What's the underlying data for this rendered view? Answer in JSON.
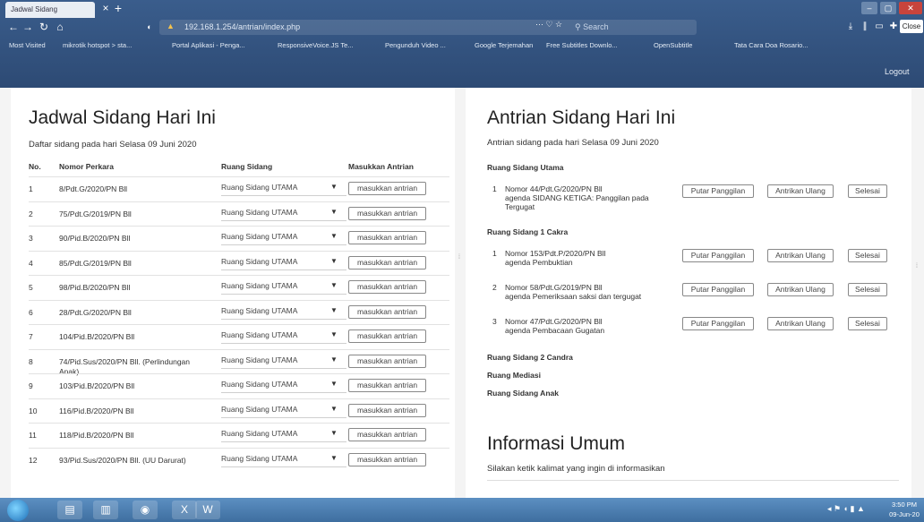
{
  "browser": {
    "tab_title": "Jadwal Sidang",
    "tab_close": "×",
    "tab_new": "+",
    "win_min": "–",
    "win_max": "▢",
    "win_close": "✕",
    "url": "192.168.1.254/antrian/index.php",
    "url_actions": "··· ♡ ☆",
    "search_placeholder": "Search",
    "close_label": "Close",
    "bookmarks": [
      "Most Visited",
      "mikrotik hotspot > sta...",
      "Portal Aplikasi - Penga...",
      "ResponsiveVoice.JS Te...",
      "Pengunduh Video ...",
      "Google Terjemahan",
      "Free Subtitles Downlo...",
      "OpenSubtitle",
      "Tata Cara Doa Rosario..."
    ],
    "logout": "Logout"
  },
  "left": {
    "title": "Jadwal Sidang Hari Ini",
    "subtitle": "Daftar sidang pada hari Selasa 09 Juni 2020",
    "headers": {
      "no": "No.",
      "perkara": "Nomor Perkara",
      "ruang": "Ruang Sidang",
      "antrian": "Masukkan Antrian"
    },
    "button_label": "masukkan antrian",
    "rows": [
      {
        "no": "1",
        "perkara": "8/Pdt.G/2020/PN Bll",
        "ruang": "Ruang Sidang UTAMA"
      },
      {
        "no": "2",
        "perkara": "75/Pdt.G/2019/PN Bll",
        "ruang": "Ruang Sidang UTAMA"
      },
      {
        "no": "3",
        "perkara": "90/Pid.B/2020/PN Bll",
        "ruang": "Ruang Sidang UTAMA"
      },
      {
        "no": "4",
        "perkara": "85/Pdt.G/2019/PN Bll",
        "ruang": "Ruang Sidang UTAMA"
      },
      {
        "no": "5",
        "perkara": "98/Pid.B/2020/PN Bll",
        "ruang": "Ruang Sidang UTAMA"
      },
      {
        "no": "6",
        "perkara": "28/Pdt.G/2020/PN Bll",
        "ruang": "Ruang Sidang UTAMA"
      },
      {
        "no": "7",
        "perkara": "104/Pid.B/2020/PN Bll",
        "ruang": "Ruang Sidang UTAMA"
      },
      {
        "no": "8",
        "perkara": "74/Pid.Sus/2020/PN Bll. (Perlindungan Anak)",
        "ruang": "Ruang Sidang UTAMA"
      },
      {
        "no": "9",
        "perkara": "103/Pid.B/2020/PN Bll",
        "ruang": "Ruang Sidang UTAMA"
      },
      {
        "no": "10",
        "perkara": "116/Pid.B/2020/PN Bll",
        "ruang": "Ruang Sidang UTAMA"
      },
      {
        "no": "11",
        "perkara": "118/Pid.B/2020/PN Bll",
        "ruang": "Ruang Sidang UTAMA"
      },
      {
        "no": "12",
        "perkara": "93/Pid.Sus/2020/PN Bll. (UU Darurat)",
        "ruang": "Ruang Sidang UTAMA"
      }
    ]
  },
  "right": {
    "title": "Antrian Sidang Hari Ini",
    "subtitle": "Antrian sidang pada hari Selasa 09 Juni 2020",
    "btn_putar": "Putar Panggilan",
    "btn_ulang": "Antrikan Ulang",
    "btn_selesai": "Selesai",
    "rooms": [
      {
        "name": "Ruang Sidang Utama",
        "items": [
          {
            "no": "1",
            "nomor": "Nomor 44/Pdt.G/2020/PN Bll",
            "agenda": "agenda SIDANG KETIGA: Panggilan pada Tergugat"
          }
        ]
      },
      {
        "name": "Ruang Sidang 1 Cakra",
        "items": [
          {
            "no": "1",
            "nomor": "Nomor 153/Pdt.P/2020/PN Bll",
            "agenda": "agenda Pembuktian"
          },
          {
            "no": "2",
            "nomor": "Nomor 58/Pdt.G/2019/PN Bll",
            "agenda": "agenda Pemeriksaan saksi dan tergugat"
          },
          {
            "no": "3",
            "nomor": "Nomor 47/Pdt.G/2020/PN Bll",
            "agenda": "agenda Pembacaan Gugatan"
          }
        ]
      },
      {
        "name": "Ruang Sidang 2 Candra",
        "items": []
      },
      {
        "name": "Ruang Mediasi",
        "items": []
      },
      {
        "name": "Ruang Sidang Anak",
        "items": []
      }
    ],
    "info_title": "Informasi Umum",
    "info_sub": "Silakan ketik kalimat yang ingin di informasikan"
  },
  "taskbar": {
    "time": "3:50 PM",
    "date": "09-Jun-20"
  }
}
